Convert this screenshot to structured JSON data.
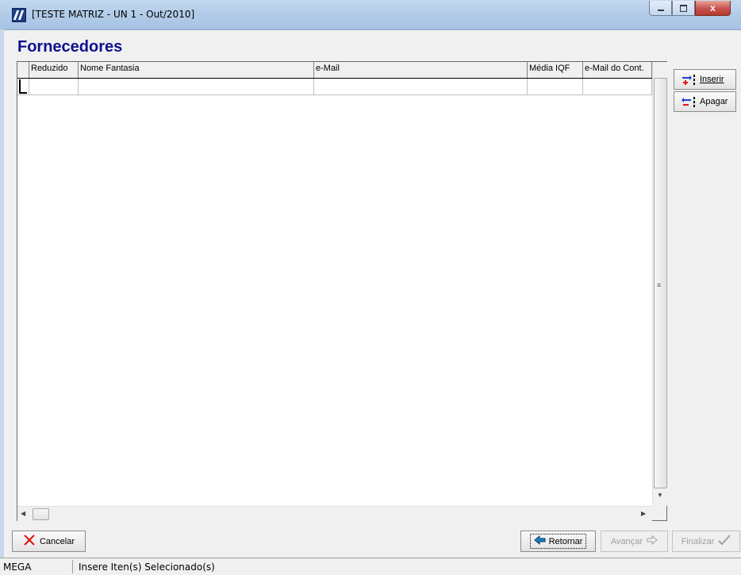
{
  "window": {
    "title": "[TESTE MATRIZ - UN 1 - Out/2010]",
    "controls": {
      "minimize": "minimize-icon",
      "maximize": "maximize-icon",
      "close": "x"
    }
  },
  "page": {
    "title": "Fornecedores"
  },
  "grid": {
    "columns": [
      "Reduzido",
      "Nome Fantasia",
      "e-Mail",
      "Média IQF",
      "e-Mail do Cont."
    ],
    "rows": [
      [
        "",
        "",
        "",
        "",
        ""
      ]
    ]
  },
  "side_buttons": {
    "insert": {
      "label": "Inserir",
      "accent": "#e0141a"
    },
    "delete": {
      "label": "Apagar",
      "accent": "#e0141a"
    }
  },
  "footer": {
    "cancel_label": "Cancelar",
    "back_label": "Retornar",
    "next_label": "Avançar",
    "finish_label": "Finalizar"
  },
  "status_bar": {
    "left": "MEGA",
    "message": "Insere Iten(s) Selecionado(s)"
  },
  "colors": {
    "title_blue": "#0f0f8f",
    "cancel_x": "#e01010",
    "back_arrow": "#1a7fc0"
  }
}
